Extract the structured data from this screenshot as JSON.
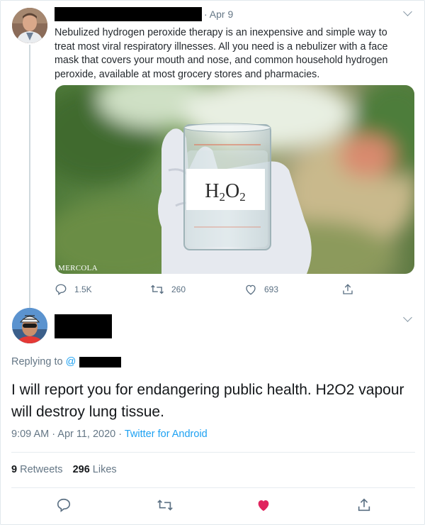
{
  "tweet1": {
    "date": "Apr 9",
    "text": "Nebulized hydrogen peroxide therapy is an inexpensive and simple way to treat most viral respiratory illnesses. All you need is a nebulizer with a face mask that covers your mouth and nose, and common household hydrogen peroxide, available at most grocery stores and pharmacies.",
    "media": {
      "label_main": "H",
      "label_sub1": "2",
      "label_mid": "O",
      "label_sub2": "2",
      "watermark": "MERCOLA"
    },
    "actions": {
      "replies": "1.5K",
      "retweets": "260",
      "likes": "693"
    }
  },
  "reply": {
    "replying_prefix": "Replying to ",
    "replying_at": "@",
    "text": "I will report you for endangering public health. H2O2 vapour will destroy lung tissue.",
    "time": "9:09 AM · Apr 11, 2020 · ",
    "source": "Twitter for Android",
    "retweets_count": "9",
    "retweets_label": " Retweets",
    "likes_count": "296",
    "likes_label": " Likes"
  },
  "colors": {
    "accent": "#1da1f2",
    "muted": "#657786",
    "like_active": "#e0245e",
    "text": "#14171a"
  },
  "icons": [
    "reply-icon",
    "retweet-icon",
    "like-icon",
    "share-icon",
    "chevron-down-icon"
  ]
}
